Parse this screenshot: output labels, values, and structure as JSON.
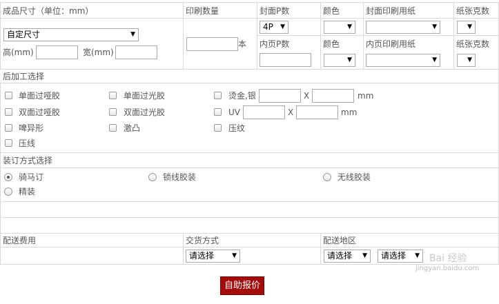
{
  "header": {
    "product_size": "成品尺寸（单位：mm）",
    "print_qty": "印刷数量",
    "cover_pages": "封面P数",
    "color": "颜色",
    "cover_paper": "封面印刷用纸",
    "paper_weight": "纸张克数"
  },
  "size": {
    "select_value": "自定尺寸",
    "height_label": "高(mm)",
    "width_label": "宽(mm)",
    "height_value": "",
    "width_value": ""
  },
  "qty": {
    "value": "",
    "unit": "本"
  },
  "cover": {
    "pages_value": "4P",
    "color_value": "",
    "paper_value": "",
    "weight_value": ""
  },
  "inner": {
    "pages_label": "内页P数",
    "color_label": "颜色",
    "paper_label": "内页印刷用纸",
    "weight_label": "纸张克数",
    "pages_value": "",
    "color_value": "",
    "paper_value": "",
    "weight_value": ""
  },
  "post": {
    "title": "后加工选择",
    "items": [
      "单面过哑胶",
      "单面过光胶",
      "烫金,银",
      "双面过哑胶",
      "双面过光胶",
      "UV",
      "啤异形",
      "激凸",
      "压纹",
      "压线"
    ],
    "x": "X",
    "mm": "mm"
  },
  "binding": {
    "title": "装订方式选择",
    "options": [
      "骑马订",
      "锁线胶装",
      "无线胶装",
      "精装"
    ],
    "selected": "骑马订"
  },
  "delivery": {
    "fee_label": "配送费用",
    "method_label": "交货方式",
    "region_label": "配送地区",
    "method_value": "请选择",
    "region1_value": "请选择",
    "region2_value": "请选择"
  },
  "submit": {
    "label": "自助报价"
  },
  "watermark": {
    "text": "Bai 经验",
    "url": "jingyan.baidu.com"
  }
}
